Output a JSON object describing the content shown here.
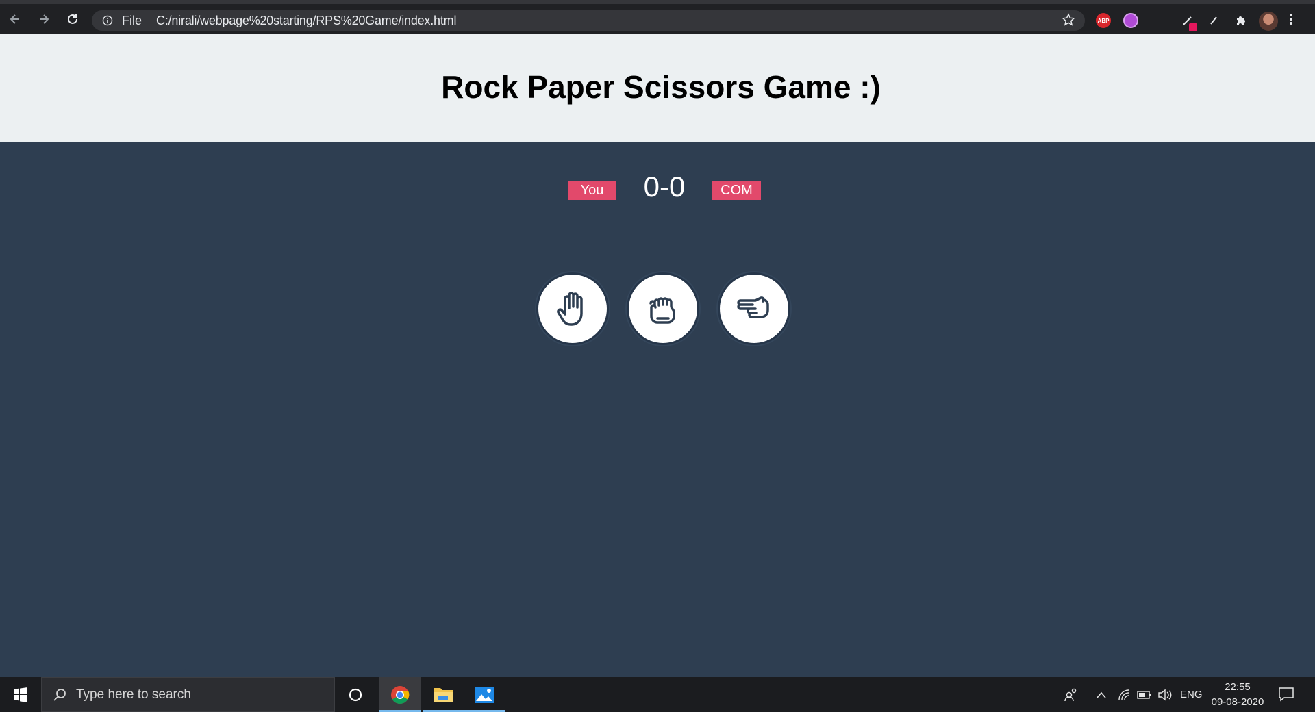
{
  "browser": {
    "protocol_label": "File",
    "url": "C:/nirali/webpage%20starting/RPS%20Game/index.html",
    "abp_label": "ABP"
  },
  "page": {
    "title": "Rock Paper Scissors Game :)"
  },
  "game": {
    "user_label": "You",
    "computer_label": "COM",
    "score": "0-0",
    "choices": [
      "paper",
      "rock",
      "scissors"
    ]
  },
  "taskbar": {
    "search_placeholder": "Type here to search",
    "language": "ENG",
    "time": "22:55",
    "date": "09-08-2020"
  },
  "colors": {
    "header_bg": "#ecf0f2",
    "game_bg": "#2e3e51",
    "badge": "#e2496b"
  }
}
